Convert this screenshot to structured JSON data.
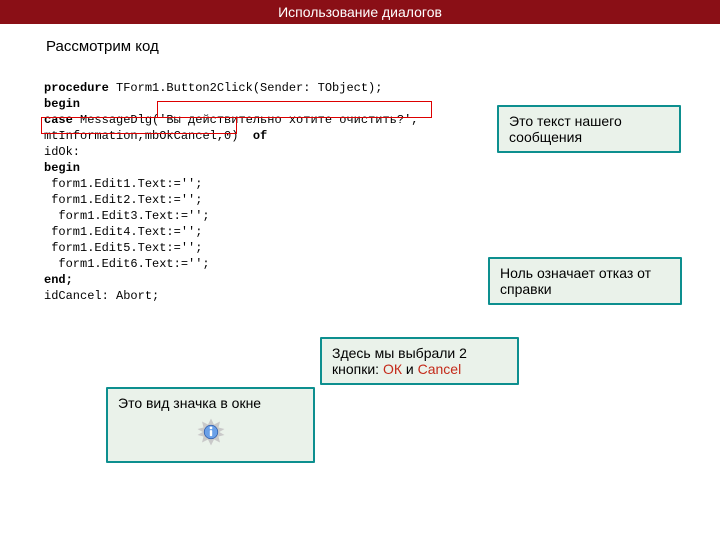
{
  "titlebar": "Использование диалогов",
  "subtitle": "Рассмотрим код",
  "code": {
    "l1a": "procedure",
    "l1b": " TForm1.Button2Click(Sender: TObject);",
    "l2": "begin",
    "l3a": "case",
    "l3b": " MessageDlg(",
    "l3c": "'Вы действительно хотите очистить?'",
    "l3d": ",",
    "l4a": "mtInformation",
    "l4b": ",",
    "l4c": "mbOkCancel",
    "l4d": ",",
    "l4e": "0",
    "l4f": ")  ",
    "l4g": "of",
    "l5": "idOk:",
    "l6": "begin",
    "l7": " form1.Edit1.Text:='';",
    "l8": " form1.Edit2.Text:='';",
    "l9": "  form1.Edit3.Text:='';",
    "l10": " form1.Edit4.Text:='';",
    "l11": " form1.Edit5.Text:='';",
    "l12": "  form1.Edit6.Text:='';",
    "l13": "end;",
    "l14": "idCancel: Abort;"
  },
  "callouts": {
    "msgtext": "Это текст нашего сообщения",
    "zero": "Ноль означает отказ от справки",
    "buttons_a": "Здесь мы выбрали 2 кнопки: ",
    "buttons_ok": "ОК",
    "buttons_and": " и ",
    "buttons_cancel": "Cancel",
    "icontype": "Это вид значка в окне"
  }
}
